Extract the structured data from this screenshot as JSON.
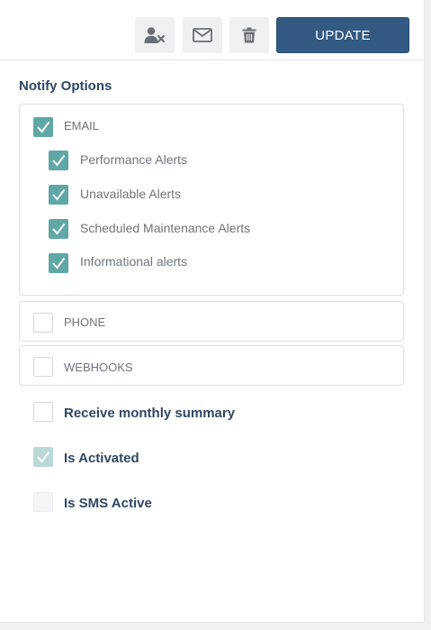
{
  "toolbar": {
    "icons": [
      "remove-user-icon",
      "envelope-icon",
      "trash-icon"
    ],
    "update_label": "UPDATE"
  },
  "notify": {
    "title": "Notify Options",
    "email": {
      "label": "EMAIL",
      "checked": true,
      "items": [
        {
          "label": "Performance Alerts",
          "checked": true
        },
        {
          "label": "Unavailable Alerts",
          "checked": true
        },
        {
          "label": "Scheduled Maintenance Alerts",
          "checked": true
        },
        {
          "label": "Informational alerts",
          "checked": true
        }
      ]
    },
    "phone": {
      "label": "PHONE",
      "checked": false
    },
    "webhooks": {
      "label": "WEBHOOKS",
      "checked": false
    }
  },
  "options": {
    "monthly_summary": {
      "label": "Receive monthly summary",
      "checked": false
    },
    "is_activated": {
      "label": "Is Activated",
      "checked": true,
      "disabled": true
    },
    "is_sms_active": {
      "label": "Is SMS Active",
      "checked": false,
      "disabled": true
    }
  },
  "colors": {
    "accent": "#335a82",
    "check": "#5fa8a6",
    "heading": "#2e4763"
  }
}
